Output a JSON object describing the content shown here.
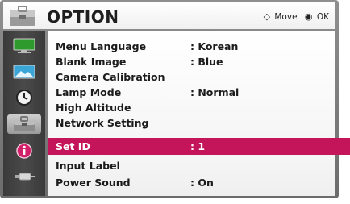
{
  "header": {
    "title": "OPTION",
    "hint_move_glyph": "◇",
    "hint_move_label": "Move",
    "hint_ok_glyph": "◉",
    "hint_ok_label": "OK"
  },
  "sidebar": {
    "icons": [
      "monitor-icon",
      "picture-icon",
      "clock-icon",
      "option-toolbox-icon",
      "info-icon",
      "input-cable-icon"
    ],
    "active_index": 3
  },
  "menu": {
    "items": [
      {
        "label": "Menu Language",
        "value": ": Korean"
      },
      {
        "label": "Blank Image",
        "value": ": Blue"
      },
      {
        "label": "Camera Calibration",
        "value": ""
      },
      {
        "label": "Lamp Mode",
        "value": ": Normal"
      },
      {
        "label": "High Altitude",
        "value": ""
      },
      {
        "label": "Network Setting",
        "value": ""
      },
      {
        "label": "Set ID",
        "value": ": 1"
      },
      {
        "label": "Input Label",
        "value": ""
      },
      {
        "label": "Power Sound",
        "value": ": On"
      }
    ],
    "selected_index": 6
  },
  "colors": {
    "selection": "#c4145a",
    "frame": "#7a7a7a",
    "sidebar": "#404040"
  }
}
